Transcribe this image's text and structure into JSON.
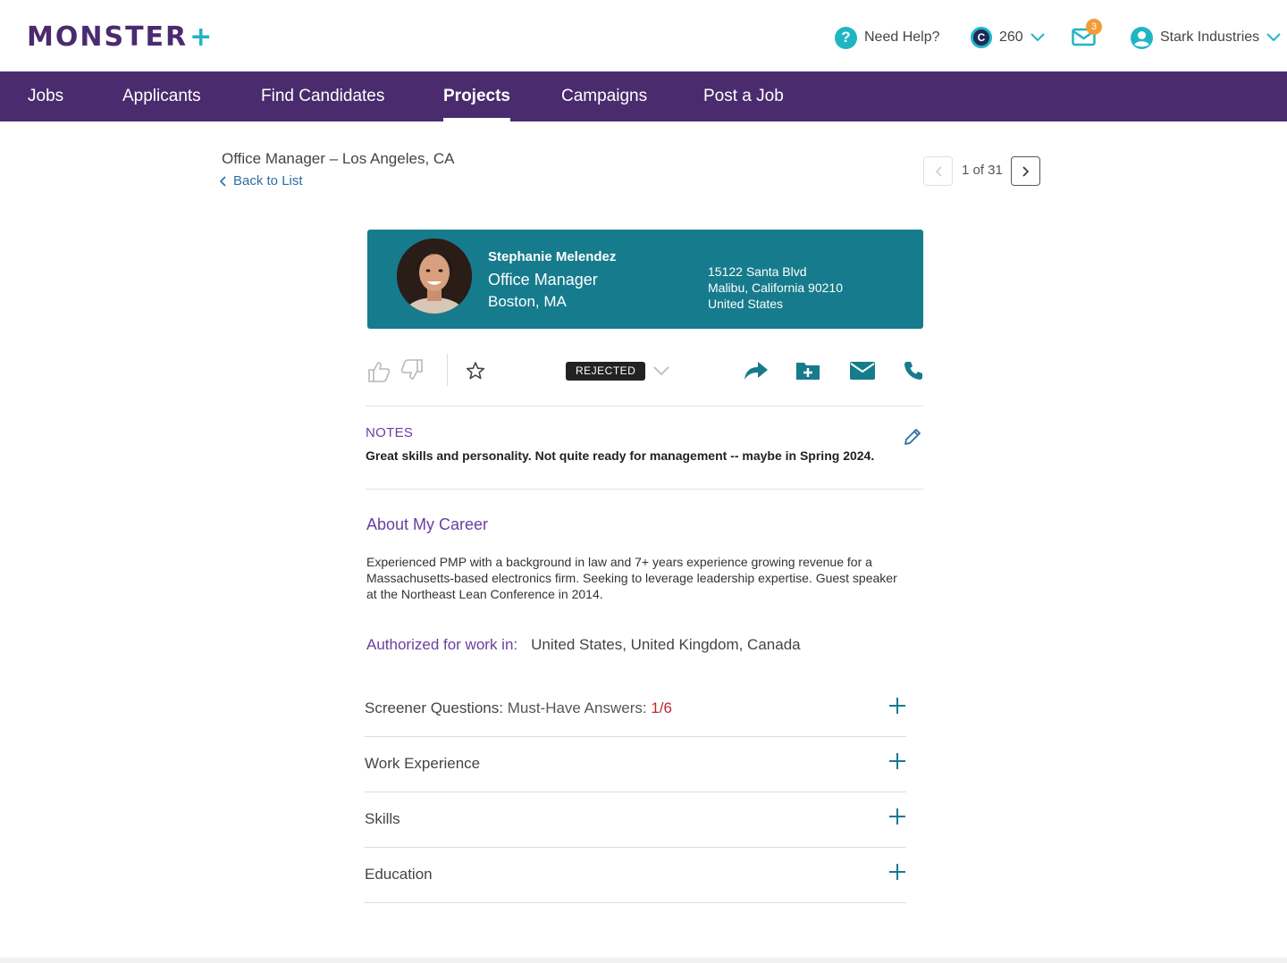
{
  "header": {
    "logo_text": "MONSTER",
    "logo_plus": "+",
    "help_label": "Need Help?",
    "help_icon": "question-icon",
    "credits_value": "260",
    "credits_icon_glyph": "C",
    "mail_badge": "3",
    "account_name": "Stark Industries"
  },
  "nav": {
    "items": [
      "Jobs",
      "Applicants",
      "Find Candidates",
      "Projects",
      "Campaigns",
      "Post a Job"
    ],
    "active": "Projects"
  },
  "page": {
    "job_title": "Office Manager – Los Angeles, CA",
    "back_label": "Back to List",
    "pager_text": "1 of 31"
  },
  "candidate": {
    "name": "Stephanie Melendez",
    "role": "Office Manager",
    "location": "Boston, MA",
    "address_line1": "15122 Santa Blvd",
    "address_line2": "Malibu, California 90210",
    "address_line3": "United States"
  },
  "actions": {
    "status": "REJECTED"
  },
  "notes": {
    "label": "NOTES",
    "text": "Great skills and personality. Not quite ready for management -- maybe in Spring 2024."
  },
  "about": {
    "title": "About My Career",
    "text": "Experienced PMP with a background in law and 7+ years experience growing revenue for a Massachusetts-based electronics firm. Seeking to leverage leadership expertise. Guest speaker at the Northeast Lean Conference in 2014."
  },
  "authorization": {
    "label": "Authorized for work in:",
    "value": "United States, United Kingdom, Canada"
  },
  "sections": {
    "screener_title": "Screener Questions:",
    "screener_sub": "Must-Have Answers:",
    "screener_score": "1/6",
    "work": "Work Experience",
    "skills": "Skills",
    "education": "Education"
  },
  "colors": {
    "brand_purple": "#4a2c6e",
    "teal": "#167b8c",
    "accent_cyan": "#1fb5c4",
    "label_purple": "#6a3ea1",
    "alert_red": "#c0272d"
  }
}
